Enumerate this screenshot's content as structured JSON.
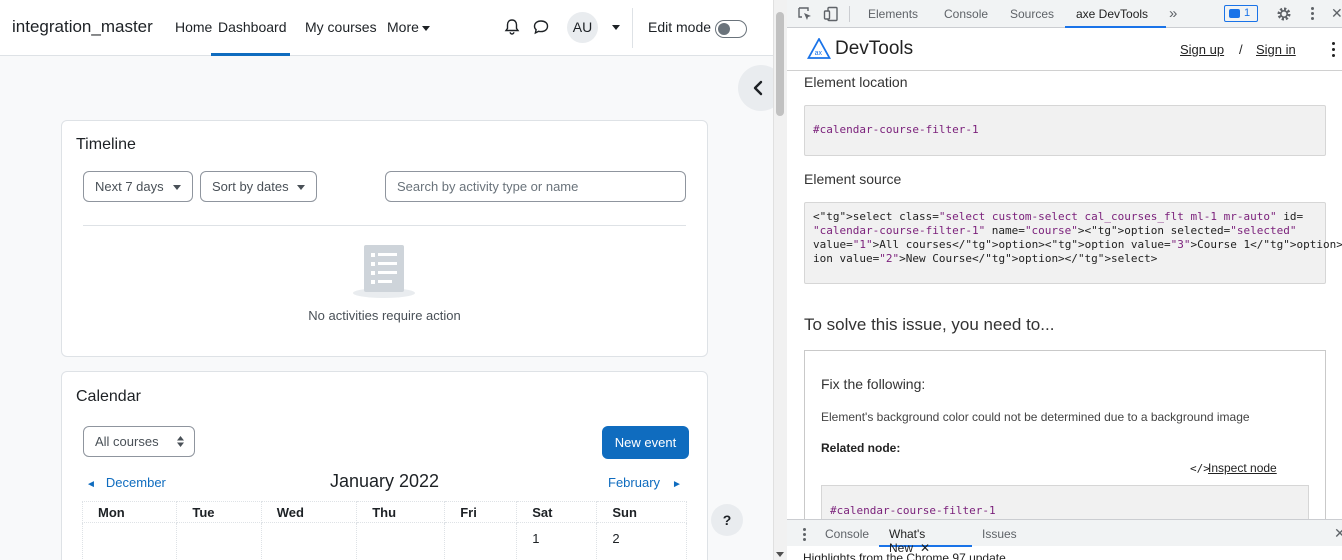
{
  "navbar": {
    "site_name": "integration_master",
    "links": [
      "Home",
      "Dashboard",
      "My courses",
      "More"
    ],
    "avatar_initials": "AU",
    "edit_mode_label": "Edit mode"
  },
  "timeline": {
    "title": "Timeline",
    "filter_select": "Next 7 days",
    "sort_select": "Sort by dates",
    "search_placeholder": "Search by activity type or name",
    "empty_message": "No activities require action"
  },
  "calendar": {
    "title": "Calendar",
    "course_select": "All courses",
    "new_event_label": "New event",
    "prev_month": "December",
    "current_month": "January 2022",
    "next_month": "February",
    "weekdays": [
      "Mon",
      "Tue",
      "Wed",
      "Thu",
      "Fri",
      "Sat",
      "Sun"
    ],
    "first_week": [
      "",
      "",
      "",
      "",
      "",
      "1",
      "2"
    ]
  },
  "help_button": "?",
  "devtools": {
    "tabs": [
      "Elements",
      "Console",
      "Sources",
      "axe DevTools"
    ],
    "more_tabs": "»",
    "issues_count": "1",
    "drawer_tabs": [
      "Console",
      "What's New",
      "Issues"
    ],
    "whats_new_text": "Highlights from the Chrome 97 update"
  },
  "axe": {
    "title": "DevTools",
    "sign_up": "Sign up",
    "separator": "/",
    "sign_in": "Sign in",
    "element_location_label": "Element location",
    "element_location_value": "#calendar-course-filter-1",
    "element_source_label": "Element source",
    "element_source_lines": [
      "<select class=\"select custom-select cal_courses_flt ml-1 mr-auto\" id=",
      "\"calendar-course-filter-1\" name=\"course\"><option selected=\"selected\"",
      "value=\"1\">All courses</option><option value=\"3\">Course 1</option><opt",
      "ion value=\"2\">New Course</option></select>"
    ],
    "solve_heading": "To solve this issue, you need to...",
    "fix_title": "Fix the following:",
    "fix_message": "Element's background color could not be determined due to a background image",
    "related_node_label": "Related node:",
    "inspect_node_label": "Inspect node",
    "related_node_value": "#calendar-course-filter-1"
  },
  "colors": {
    "moodle_primary": "#0f6cbf",
    "devtools_accent": "#1a73e8",
    "code_value": "#7a1f7a"
  }
}
